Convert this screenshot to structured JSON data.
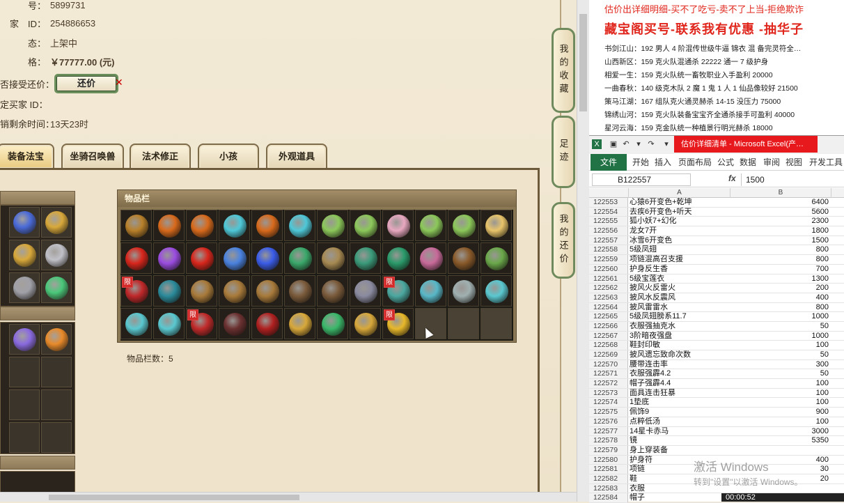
{
  "listing": {
    "rows": [
      {
        "label": "号：",
        "value": "5899731"
      },
      {
        "label": "家　ID：",
        "value": "254886653"
      },
      {
        "label": "态：",
        "value": "上架中"
      },
      {
        "label": "格：",
        "value": "￥77777.00 (元)"
      },
      {
        "label": "否接受还价：",
        "value": ""
      },
      {
        "label": "定买家 ID：",
        "value": ""
      },
      {
        "label": "销剩余时间：",
        "value": "13天23时"
      }
    ],
    "counter_offer_button": "还价"
  },
  "tabs": [
    "装备法宝",
    "坐骑召唤兽",
    "法术修正",
    "小孩",
    "外观道具"
  ],
  "inventory": {
    "title": "物品栏",
    "count_label": "物品栏数：5",
    "limited_tag": "限",
    "items": [
      {
        "icon": "ring-gold",
        "color": "#b8802a",
        "limited": false
      },
      {
        "icon": "armor-orange",
        "color": "#d86a1c",
        "limited": false
      },
      {
        "icon": "armor-orange",
        "color": "#d86a1c",
        "limited": false
      },
      {
        "icon": "beads-cyan",
        "color": "#4ec8d8",
        "limited": false
      },
      {
        "icon": "armor-orange",
        "color": "#d86a1c",
        "limited": false
      },
      {
        "icon": "beads-cyan",
        "color": "#4ec8d8",
        "limited": false
      },
      {
        "icon": "jade-amulet",
        "color": "#8cc85a",
        "limited": false
      },
      {
        "icon": "jade-amulet",
        "color": "#8cc85a",
        "limited": false
      },
      {
        "icon": "seashell-pink",
        "color": "#e8a8c0",
        "limited": false
      },
      {
        "icon": "jade-amulet",
        "color": "#8cc85a",
        "limited": false
      },
      {
        "icon": "jade-amulet",
        "color": "#8cc85a",
        "limited": false
      },
      {
        "icon": "scroll-gold",
        "color": "#e8c46a",
        "limited": false
      },
      {
        "icon": "gem-red",
        "color": "#d8261c",
        "limited": false
      },
      {
        "icon": "gem-purple",
        "color": "#9a4ce0",
        "limited": false
      },
      {
        "icon": "gem-red",
        "color": "#d8261c",
        "limited": false
      },
      {
        "icon": "crystal-blue",
        "color": "#4a82e0",
        "limited": false
      },
      {
        "icon": "orb-blue",
        "color": "#3a5ce8",
        "limited": false
      },
      {
        "icon": "mask-green",
        "color": "#3aa86a",
        "limited": false
      },
      {
        "icon": "helm-bronze",
        "color": "#a88a52",
        "limited": false
      },
      {
        "icon": "boots-teal",
        "color": "#3a9a7a",
        "limited": false
      },
      {
        "icon": "necklace-green",
        "color": "#2a9a6a",
        "limited": false
      },
      {
        "icon": "jellyfish-pink",
        "color": "#c86a9a",
        "limited": false
      },
      {
        "icon": "book-brown",
        "color": "#8a5a2a",
        "limited": false
      },
      {
        "icon": "boots-green",
        "color": "#6aa84a",
        "limited": false
      },
      {
        "icon": "blade-red",
        "color": "#c0282a",
        "limited": true
      },
      {
        "icon": "orb-teal",
        "color": "#2a8a9a",
        "limited": false
      },
      {
        "icon": "ring-bronze",
        "color": "#a87a3a",
        "limited": false
      },
      {
        "icon": "ring-bronze",
        "color": "#a87a3a",
        "limited": false
      },
      {
        "icon": "ring-bronze",
        "color": "#a87a3a",
        "limited": false
      },
      {
        "icon": "belt-brown",
        "color": "#7a5a3a",
        "limited": false
      },
      {
        "icon": "belt-brown",
        "color": "#7a5a3a",
        "limited": false
      },
      {
        "icon": "robe-grey",
        "color": "#8a8aa0",
        "limited": false
      },
      {
        "icon": "fan-teal",
        "color": "#4aa8a0",
        "limited": true
      },
      {
        "icon": "wing-cyan",
        "color": "#58b8c8",
        "limited": false
      },
      {
        "icon": "ring-silver",
        "color": "#a0b0b0",
        "limited": false
      },
      {
        "icon": "cape-cyan",
        "color": "#5ac8d0",
        "limited": false
      },
      {
        "icon": "cape-cyan",
        "color": "#5ac8d0",
        "limited": false
      },
      {
        "icon": "cape-cyan",
        "color": "#5ac8d0",
        "limited": false
      },
      {
        "icon": "robe-red",
        "color": "#c02a2a",
        "limited": true
      },
      {
        "icon": "sword-dark",
        "color": "#6a3030",
        "limited": false
      },
      {
        "icon": "charm-red",
        "color": "#b02020",
        "limited": false
      },
      {
        "icon": "mask-gold",
        "color": "#d8a83a",
        "limited": false
      },
      {
        "icon": "orb-green",
        "color": "#3ab86a",
        "limited": false
      },
      {
        "icon": "necklace-gold",
        "color": "#d8a83a",
        "limited": false
      },
      {
        "icon": "flower-gold",
        "color": "#e8b82a",
        "limited": true
      },
      {
        "icon": "empty",
        "color": "",
        "limited": false
      },
      {
        "icon": "empty",
        "color": "",
        "limited": false
      },
      {
        "icon": "empty",
        "color": "",
        "limited": false
      }
    ]
  },
  "left_equip": {
    "items": [
      {
        "icon": "helm-blue",
        "color": "#4a6ad8"
      },
      {
        "icon": "necklace-gold",
        "color": "#d8a83a"
      },
      {
        "icon": "ring-gold",
        "color": "#d8a83a"
      },
      {
        "icon": "ring-silver",
        "color": "#c0c0c8"
      },
      {
        "icon": "belt-silver",
        "color": "#a0a0a8"
      },
      {
        "icon": "orb-green",
        "color": "#4ac87a"
      }
    ],
    "lower_items": [
      {
        "icon": "scroll-purple",
        "color": "#8a6ae0"
      },
      {
        "icon": "flame-gold",
        "color": "#e88a2a"
      }
    ]
  },
  "side_tabs": [
    "我的收藏",
    "足迹",
    "我的还价"
  ],
  "notes": {
    "warning": "估价出详细明细-买不了吃亏-卖不了上当-拒绝欺诈",
    "title": "藏宝阁买号-联系我有优惠 -抽华子",
    "lines": [
      "书剑江山：192 男人 4 阶混传世级牛逼 锦衣 混 备完灵符全…",
      "山西新区：159 克火队混通杀 22222 通一 7 级护身",
      "相爱一生：159 克火队统一畜牧职业入手盈利 20000",
      "一曲春秋：140 级克木队 2 魔 1 鬼 1 人 1 仙品像较好 21500",
      "策马江湖：167 组队克火通灵赫杀 14-15 没压力 75000",
      "锦绣山河：159 克火队装备宝宝齐全通杀接手可盈利 40000",
      "星河云海：159 克金队统一种植景行明光赫杀 18000"
    ]
  },
  "excel": {
    "window_title": "估价详细清单 - Microsoft Excel(产…",
    "ribbon_file": "文件",
    "ribbon_tabs": [
      "开始",
      "插入",
      "页面布局",
      "公式",
      "数据",
      "审阅",
      "视图",
      "开发工具"
    ],
    "name_box": "B122557",
    "formula_value": "1500",
    "col_a": "A",
    "col_b": "B",
    "rows": [
      {
        "n": "122553",
        "a": "心猿6开变色+乾坤",
        "b": "6400"
      },
      {
        "n": "122554",
        "a": "去疾6开变色+听天",
        "b": "5600"
      },
      {
        "n": "122555",
        "a": "狐小妖7+幻化",
        "b": "2300"
      },
      {
        "n": "122556",
        "a": "龙女7开",
        "b": "1800"
      },
      {
        "n": "122557",
        "a": "冰雪6开变色",
        "b": "1500"
      },
      {
        "n": "122558",
        "a": "5级凤翅",
        "b": "800"
      },
      {
        "n": "122559",
        "a": "项链混高召支援",
        "b": "800"
      },
      {
        "n": "122560",
        "a": "护身反生香",
        "b": "700"
      },
      {
        "n": "122561",
        "a": "5级宝莲衣",
        "b": "1300"
      },
      {
        "n": "122562",
        "a": "披风火反雷火",
        "b": "200"
      },
      {
        "n": "122563",
        "a": "披风水反震风",
        "b": "400"
      },
      {
        "n": "122564",
        "a": "披风雷雷水",
        "b": "800"
      },
      {
        "n": "122565",
        "a": "5级凤翅膀系11.7",
        "b": "1000"
      },
      {
        "n": "122566",
        "a": "衣服强抽克水",
        "b": "50"
      },
      {
        "n": "122567",
        "a": "3阶暗夜强盘",
        "b": "1000"
      },
      {
        "n": "122568",
        "a": "鞋封印敏",
        "b": "100"
      },
      {
        "n": "122569",
        "a": "披风遗忘致命次数",
        "b": "50"
      },
      {
        "n": "122570",
        "a": "腰带连击率",
        "b": "300"
      },
      {
        "n": "122571",
        "a": "衣服强霹4.2",
        "b": "50"
      },
      {
        "n": "122572",
        "a": "帽子强霹4.4",
        "b": "100"
      },
      {
        "n": "122573",
        "a": "面具连击狂暴",
        "b": "100"
      },
      {
        "n": "122574",
        "a": "1垫底",
        "b": "100"
      },
      {
        "n": "122575",
        "a": "佩饰9",
        "b": "900"
      },
      {
        "n": "122576",
        "a": "点粹低汤",
        "b": "100"
      },
      {
        "n": "122577",
        "a": "14星卡赤马",
        "b": "3000"
      },
      {
        "n": "122578",
        "a": "镜",
        "b": "5350"
      },
      {
        "n": "122579",
        "a": "身上穿装备",
        "b": ""
      },
      {
        "n": "122580",
        "a": "护身符",
        "b": "400"
      },
      {
        "n": "122581",
        "a": "项链",
        "b": "30"
      },
      {
        "n": "122582",
        "a": "鞋",
        "b": "20"
      },
      {
        "n": "122583",
        "a": "衣服",
        "b": ""
      },
      {
        "n": "122584",
        "a": "帽子",
        "b": ""
      }
    ]
  },
  "watermark": {
    "line1": "激活 Windows",
    "line2": "转到\"设置\"以激活 Windows。"
  },
  "timer": "00:00:52"
}
